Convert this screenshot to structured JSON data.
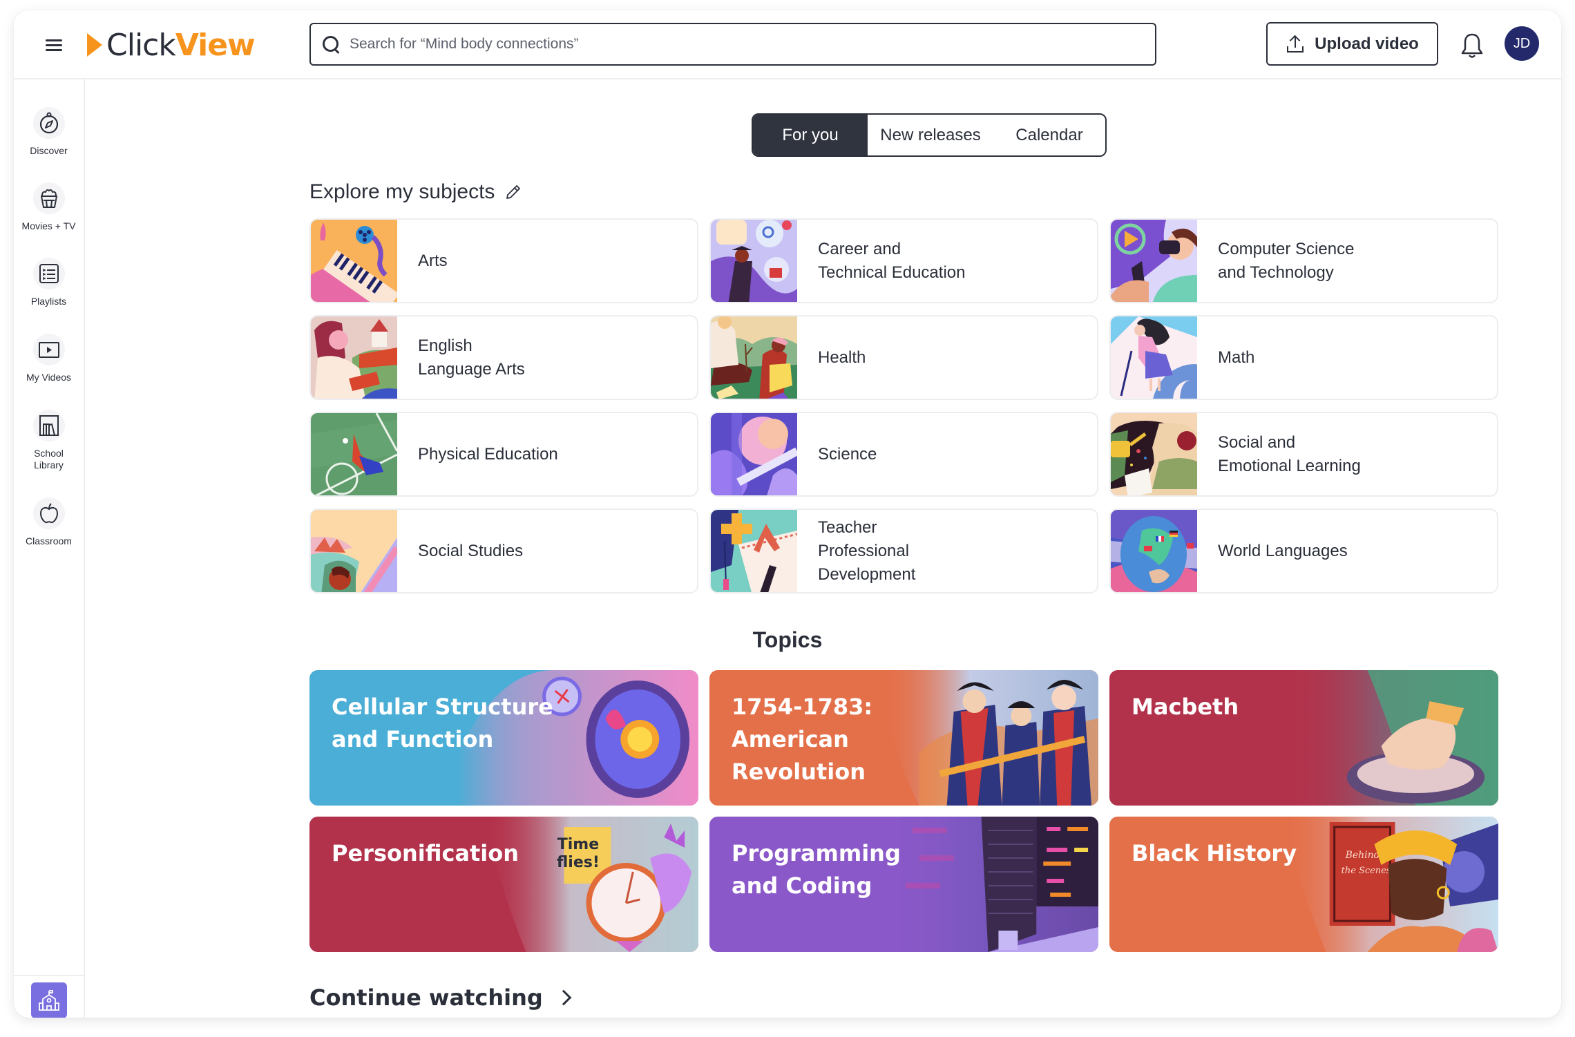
{
  "app": {
    "logo_left": "Click",
    "logo_right": "View",
    "brand_color": "#f7941d"
  },
  "header": {
    "menu_icon": "hamburger-icon",
    "search_placeholder": "Search for “Mind body connections”",
    "upload_label": "Upload video",
    "notifications_icon": "bell-icon",
    "avatar_initials": "JD",
    "avatar_color": "#23296b"
  },
  "sidebar": {
    "items": [
      {
        "label": "Discover",
        "icon": "compass-icon"
      },
      {
        "label": "Movies + TV",
        "icon": "popcorn-icon"
      },
      {
        "label": "Playlists",
        "icon": "playlist-icon"
      },
      {
        "label": "My Videos",
        "icon": "play-box-icon"
      },
      {
        "label": "School\nLibrary",
        "icon": "library-icon"
      },
      {
        "label": "Classroom",
        "icon": "apple-icon"
      }
    ],
    "school_button_icon": "school-building-icon",
    "school_button_color": "#7a6fe0"
  },
  "tabs": [
    {
      "label": "For you",
      "active": true
    },
    {
      "label": "New releases",
      "active": false
    },
    {
      "label": "Calendar",
      "active": false
    }
  ],
  "explore": {
    "title": "Explore my subjects",
    "subjects": [
      {
        "label": "Arts"
      },
      {
        "label": "Career and\nTechnical Education"
      },
      {
        "label": "Computer Science\nand Technology"
      },
      {
        "label": "English\nLanguage Arts"
      },
      {
        "label": "Health"
      },
      {
        "label": "Math"
      },
      {
        "label": "Physical Education"
      },
      {
        "label": "Science"
      },
      {
        "label": "Social and\nEmotional Learning"
      },
      {
        "label": "Social Studies"
      },
      {
        "label": "Teacher\nProfessional\nDevelopment"
      },
      {
        "label": "World Languages"
      }
    ]
  },
  "topics": {
    "title": "Topics",
    "items": [
      {
        "label": "Cellular Structure\nand Function",
        "color": "#4aaed6"
      },
      {
        "label": "1754-1783:\nAmerican\nRevolution",
        "color": "#e4704a"
      },
      {
        "label": "Macbeth",
        "color": "#b3324b"
      },
      {
        "label": "Personification",
        "color": "#b3324b"
      },
      {
        "label": "Programming\nand Coding",
        "color": "#8a58c8"
      },
      {
        "label": "Black History",
        "color": "#e4704a"
      }
    ]
  },
  "continue_watching": {
    "title": "Continue watching"
  }
}
